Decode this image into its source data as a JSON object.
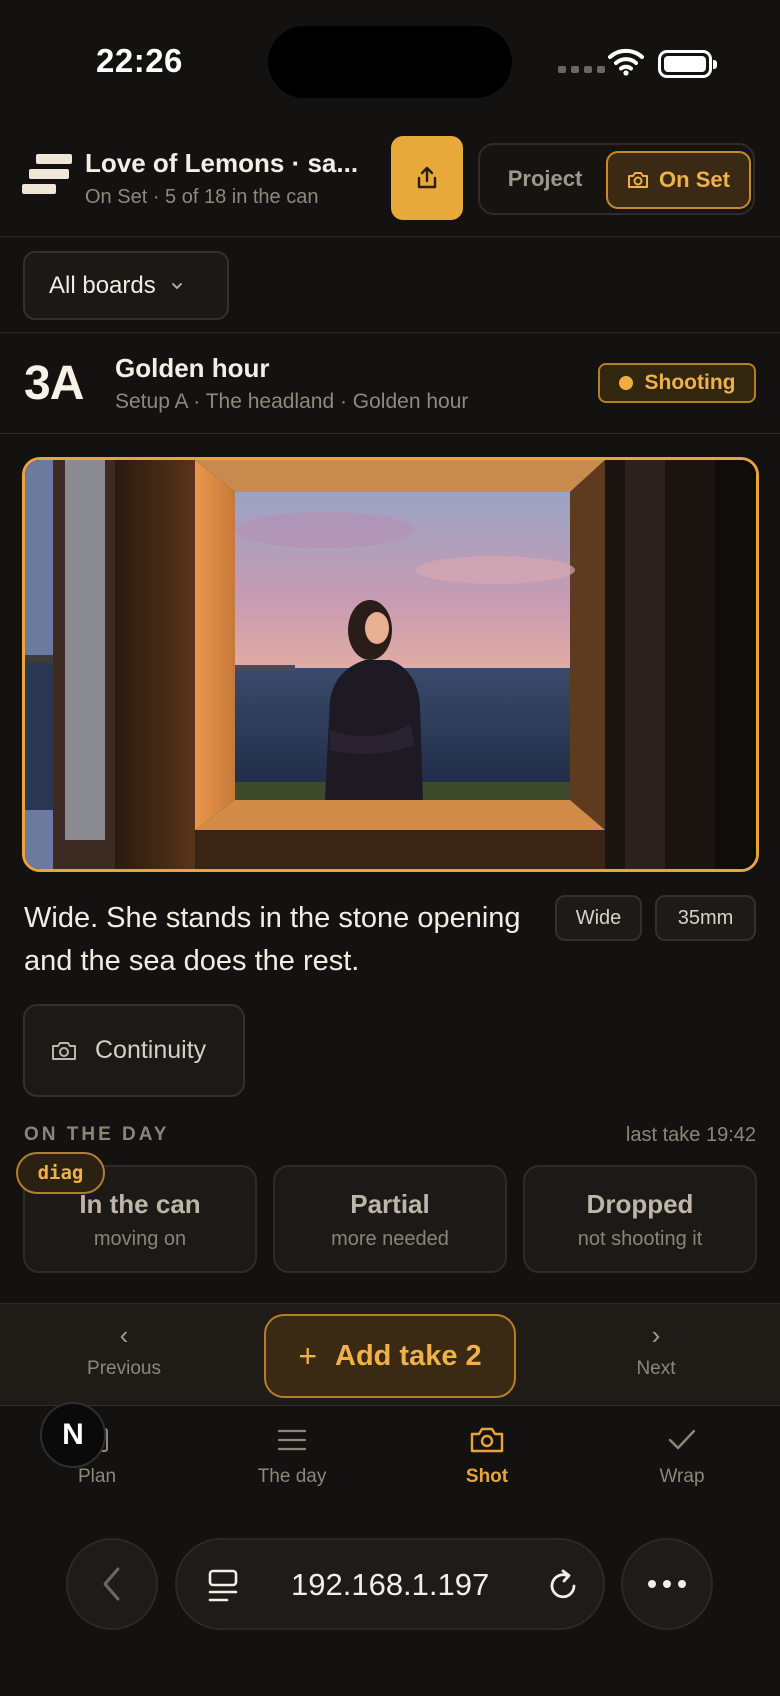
{
  "status_bar": {
    "time": "22:26"
  },
  "header": {
    "title": "Love of Lemons · sa...",
    "subtitle": "On Set · 5 of 18 in the can",
    "share_icon": "share-icon",
    "mode_project": "Project",
    "mode_onset": "On Set"
  },
  "boards": {
    "label": "All boards"
  },
  "setup": {
    "number": "3A",
    "title": "Golden hour",
    "subtitle": "Setup A · The headland · Golden hour",
    "status": "Shooting"
  },
  "shot": {
    "description": "Wide. She stands in the stone opening and the sea does the rest.",
    "tags": [
      "Wide",
      "35mm"
    ],
    "continuity_label": "Continuity"
  },
  "on_the_day": {
    "label": "ON THE DAY",
    "last_take": "last take 19:42",
    "options": [
      {
        "title": "In the can",
        "sub": "moving on"
      },
      {
        "title": "Partial",
        "sub": "more needed"
      },
      {
        "title": "Dropped",
        "sub": "not shooting it"
      }
    ],
    "diag_badge": "diag"
  },
  "action_bar": {
    "previous": "Previous",
    "add_take": "Add take 2",
    "next": "Next"
  },
  "tabs": [
    {
      "label": "Plan",
      "icon": "plan-icon"
    },
    {
      "label": "The day",
      "icon": "list-icon"
    },
    {
      "label": "Shot",
      "icon": "camera-icon"
    },
    {
      "label": "Wrap",
      "icon": "check-icon"
    }
  ],
  "active_tab": "Shot",
  "floating_badge": "N",
  "browser": {
    "url": "192.168.1.197"
  },
  "colors": {
    "accent": "#e8a93b",
    "background": "#141210"
  }
}
